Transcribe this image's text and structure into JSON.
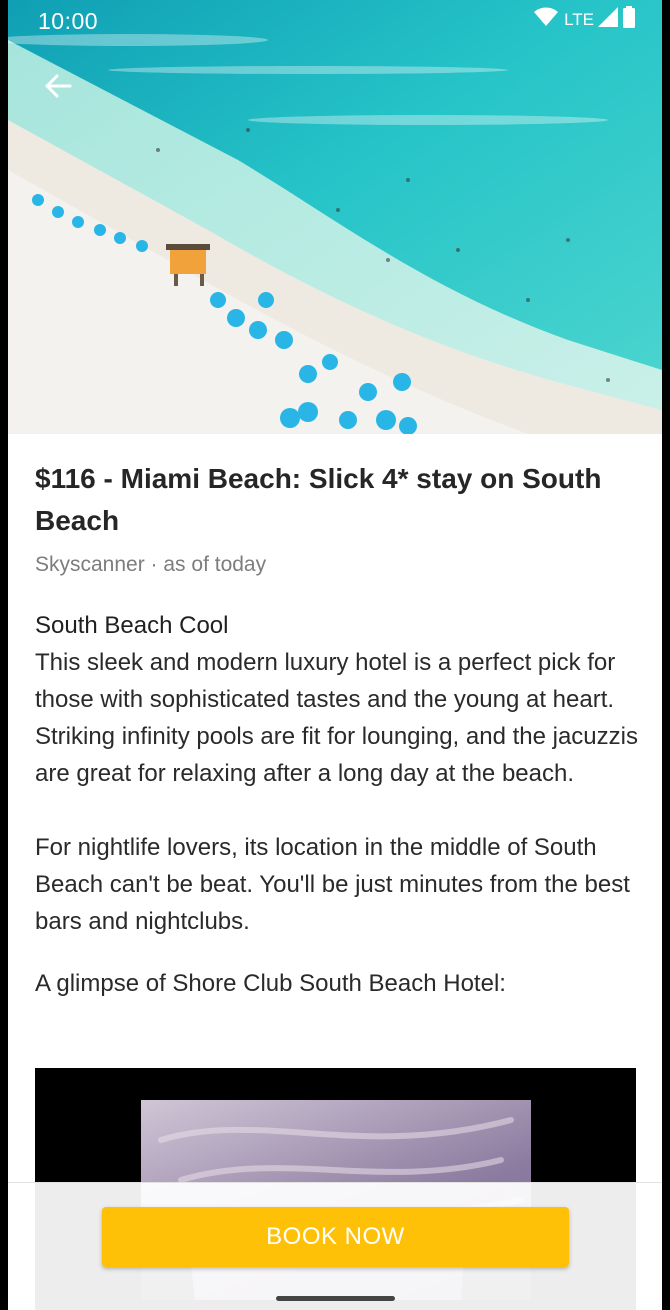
{
  "status_bar": {
    "time": "10:00",
    "network_label": "LTE",
    "icons": [
      "wifi-icon",
      "cellular-signal-icon",
      "battery-icon"
    ]
  },
  "header": {
    "back_icon": "arrow-left-icon"
  },
  "hero": {
    "description_icon": "beach-photo"
  },
  "article": {
    "title": "$116 - Miami Beach: Slick 4* stay on South Beach",
    "source": "Skyscanner · as of today",
    "section_heading": "South Beach Cool",
    "paragraph_1": "This sleek and modern luxury hotel is a perfect pick for those with sophisticated tastes and the young at heart. Striking infinity pools are fit for lounging, and the jacuzzis are great for relaxing after a long day at the beach.",
    "paragraph_2": "For nightlife lovers, its location in the middle of South Beach can't be beat. You'll be just minutes from the best bars and nightclubs.",
    "glimpse_label": "A glimpse of Shore Club South Beach Hotel:"
  },
  "footer": {
    "book_button_label": "BOOK NOW"
  },
  "colors": {
    "accent": "#ffc107",
    "sea": "#1fc2c5",
    "sand": "#efece6",
    "umbrella": "#29b6e6"
  }
}
